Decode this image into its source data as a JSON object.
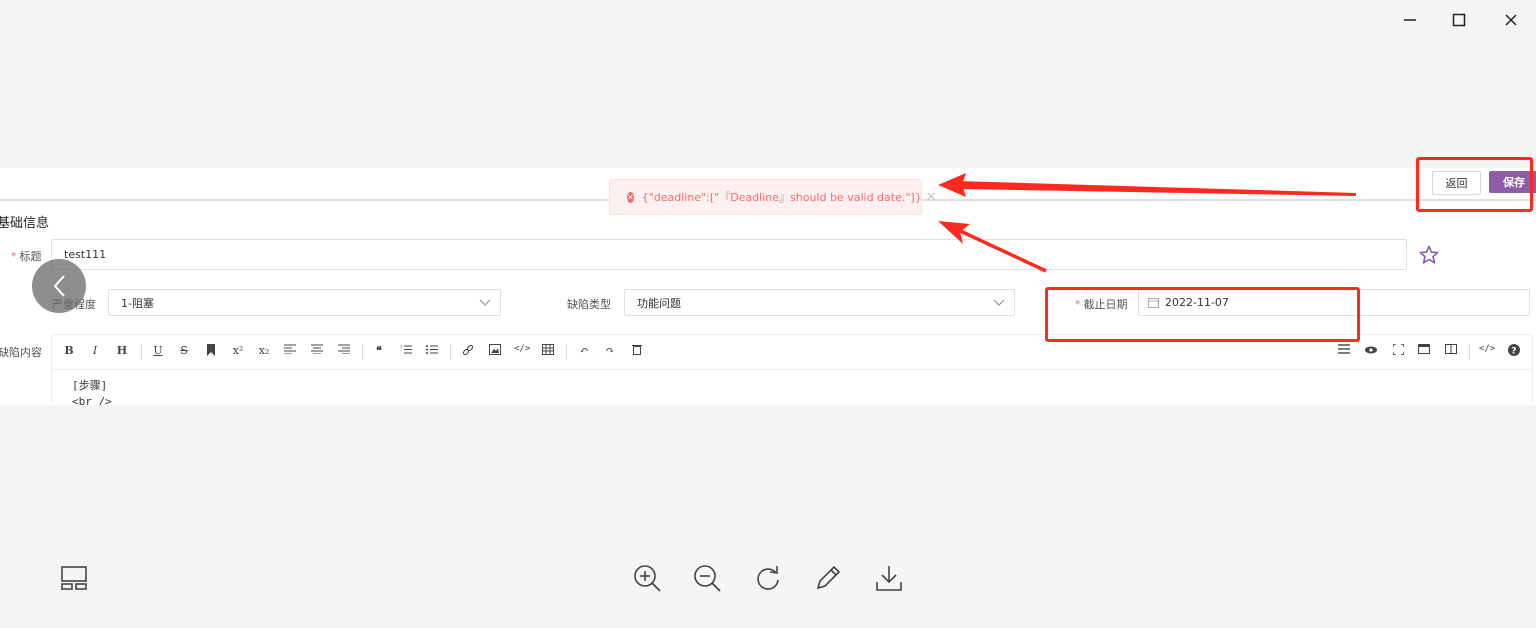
{
  "window": {
    "minimize_icon": "minimize-icon",
    "maximize_icon": "maximize-icon",
    "close_icon": "close-icon"
  },
  "header": {
    "back_label": "返回",
    "save_label": "保存",
    "save_color": "#8e5ba6"
  },
  "toast": {
    "message": "{\"deadline\":[\"『Deadline』should be valid date.\"]}",
    "close_glyph": "✕",
    "error_glyph": "✕",
    "color": "#f56c6c"
  },
  "form": {
    "section_title": "基础信息",
    "required_mark": "*",
    "title_label": "标题",
    "title_value": "test111",
    "severity_label": "严重程度",
    "severity_value": "1-阻塞",
    "bug_type_label": "缺陷类型",
    "bug_type_value": "功能问题",
    "deadline_label": "截止日期",
    "deadline_value": "2022-11-07",
    "content_label": "缺陷内容"
  },
  "editor": {
    "lines": [
      "[步骤]",
      "<br />"
    ]
  },
  "viewer_tools": [
    "layout-icon",
    "zoom-in-icon",
    "zoom-out-icon",
    "rotate-icon",
    "edit-icon",
    "download-icon"
  ],
  "annotation_color": "#ff2a1f"
}
